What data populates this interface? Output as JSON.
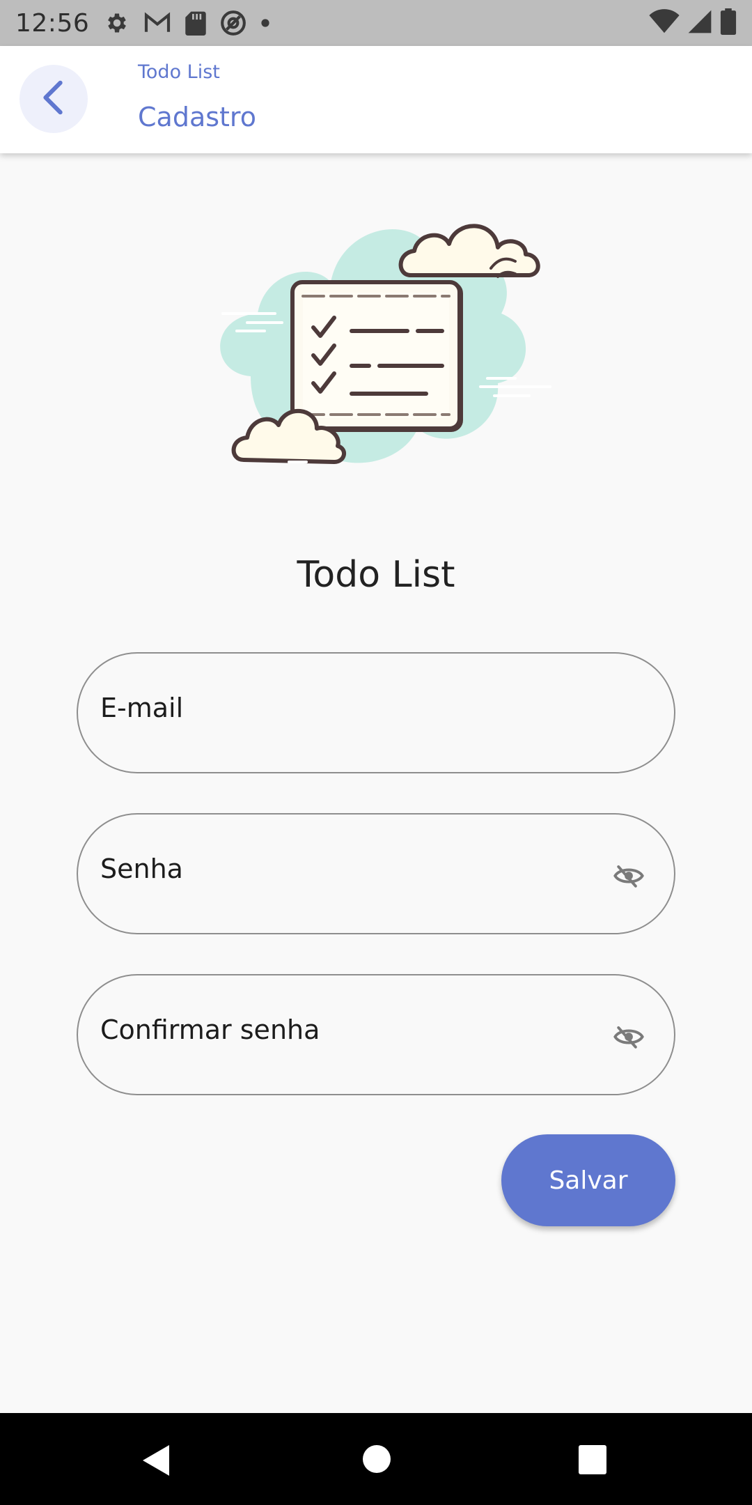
{
  "status_bar": {
    "time": "12:56",
    "icons": [
      "gear-icon",
      "gmail-icon",
      "sd-card-icon",
      "at-sign-icon",
      "dot-icon",
      "wifi-icon",
      "cell-signal-icon",
      "battery-icon"
    ]
  },
  "app_bar": {
    "subtitle": "Todo List",
    "title": "Cadastro",
    "back_icon": "chevron-left-icon"
  },
  "illustration": "checklist-clouds-illustration",
  "heading": "Todo List",
  "form": {
    "email": {
      "placeholder": "E-mail",
      "value": ""
    },
    "password": {
      "placeholder": "Senha",
      "value": "",
      "icon": "eye-off-icon"
    },
    "confirm_password": {
      "placeholder": "Confirmar senha",
      "value": "",
      "icon": "eye-off-icon"
    }
  },
  "save_button": {
    "label": "Salvar"
  },
  "nav_bar": {
    "icons": [
      "nav-back-icon",
      "nav-home-icon",
      "nav-recents-icon"
    ]
  },
  "colors": {
    "accent": "#5f77cf",
    "background": "#f9f9f9",
    "status_bar": "#bdbdbd",
    "nav_bar": "#000000"
  }
}
